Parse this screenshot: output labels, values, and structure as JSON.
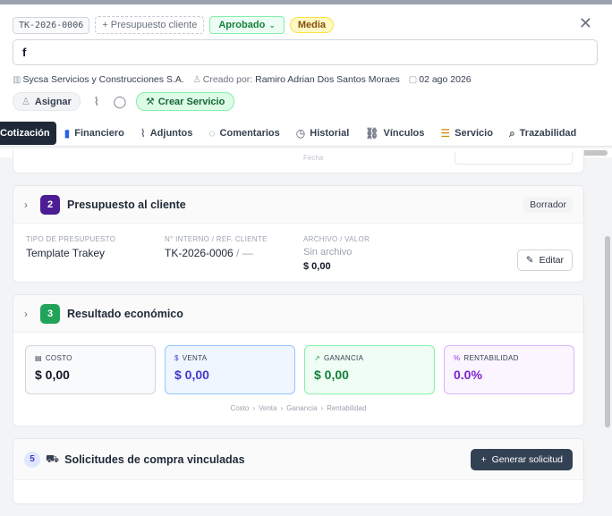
{
  "header": {
    "code": "TK-2026-0006",
    "budget_button": "+ Presupuesto cliente",
    "status": "Aprobado",
    "priority": "Media",
    "title_value": "f",
    "company": "Sycsa Servicios y Construcciones S.A.",
    "created_by_label": "Creado por:",
    "created_by": "Ramiro Adrian Dos Santos Moraes",
    "date": "02 ago 2026",
    "assign_label": "Asignar",
    "create_service_label": "Crear Servicio"
  },
  "tabs": [
    {
      "label": "Cotización",
      "icon": "document-icon"
    },
    {
      "label": "Financiero",
      "icon": "bar-chart-icon"
    },
    {
      "label": "Adjuntos",
      "icon": "paperclip-icon"
    },
    {
      "label": "Comentarios",
      "icon": "speech-bubble-icon"
    },
    {
      "label": "Historial",
      "icon": "clock-icon"
    },
    {
      "label": "Vínculos",
      "icon": "link-icon"
    },
    {
      "label": "Servicio",
      "icon": "gantt-icon"
    },
    {
      "label": "Trazabilidad",
      "icon": "magnifier-icon"
    }
  ],
  "prev_card": {
    "ghost_label": "Fecha"
  },
  "budget_section": {
    "number": "2",
    "title": "Presupuesto al cliente",
    "badge": "Borrador",
    "type_label": "TIPO DE PRESUPUESTO",
    "type_value": "Template Trakey",
    "ref_label": "N° INTERNO / REF. CLIENTE",
    "ref_value": "TK-2026-0006",
    "ref_suffix": " / —",
    "file_label": "ARCHIVO / VALOR",
    "file_value": "Sin archivo",
    "amount": "$ 0,00",
    "edit_label": "Editar"
  },
  "result_section": {
    "number": "3",
    "title": "Resultado económico",
    "metrics": [
      {
        "label": "COSTO",
        "value": "$ 0,00"
      },
      {
        "label": "VENTA",
        "value": "$ 0,00"
      },
      {
        "label": "GANANCIA",
        "value": "$ 0,00"
      },
      {
        "label": "RENTABILIDAD",
        "value": "0.0%"
      }
    ],
    "flow": [
      "Costo",
      "Venta",
      "Ganancia",
      "Rentabilidad"
    ]
  },
  "purchase_section": {
    "number": "5",
    "title": "Solicitudes de compra vinculadas",
    "button": "Generar solicitud"
  },
  "colors": {
    "primary_dark": "#1f2937",
    "approved": "#15803d",
    "badge2": "#4c1d95",
    "badge3": "#22a35a",
    "venta": "#4338ca",
    "rent": "#7e22ce"
  }
}
